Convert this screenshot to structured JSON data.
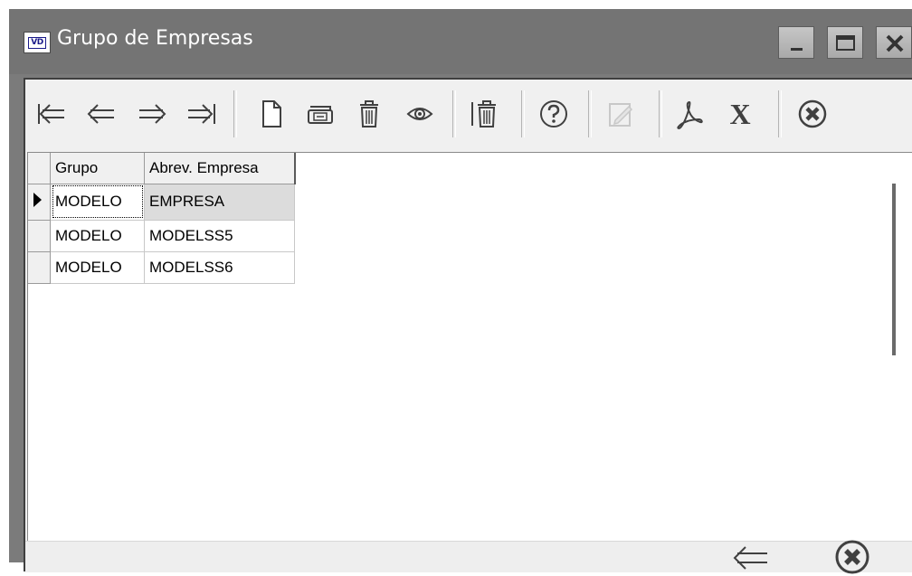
{
  "window": {
    "title": "Grupo de Empresas",
    "app_icon_text": "VD"
  },
  "title_buttons": [
    "minimize-icon",
    "maximize-icon",
    "close-icon"
  ],
  "toolbar": {
    "buttons": [
      {
        "name": "first-record-icon",
        "enabled": true
      },
      {
        "name": "previous-record-icon",
        "enabled": true
      },
      {
        "name": "next-record-icon",
        "enabled": true
      },
      {
        "name": "last-record-icon",
        "enabled": true
      },
      {
        "name": "new-document-icon",
        "enabled": true
      },
      {
        "name": "open-folder-icon",
        "enabled": true
      },
      {
        "name": "delete-trash-icon",
        "enabled": true
      },
      {
        "name": "view-eye-icon",
        "enabled": true
      },
      {
        "name": "delete-all-icon",
        "enabled": true
      },
      {
        "name": "help-icon",
        "enabled": true
      },
      {
        "name": "edit-icon",
        "enabled": false
      },
      {
        "name": "pdf-icon",
        "enabled": true
      },
      {
        "name": "excel-icon",
        "enabled": true
      },
      {
        "name": "close-circle-icon",
        "enabled": true
      }
    ],
    "excel_label": "X"
  },
  "grid": {
    "columns": [
      "Grupo",
      "Abrev. Empresa"
    ],
    "rows": [
      {
        "grupo": "MODELO",
        "empresa": "EMPRESA",
        "selected": true
      },
      {
        "grupo": "MODELO",
        "empresa": "MODELSS5",
        "selected": false
      },
      {
        "grupo": "MODELO",
        "empresa": "MODELSS6",
        "selected": false
      }
    ]
  },
  "footer": {
    "buttons": [
      "back-arrow-icon",
      "close-circle-icon"
    ]
  },
  "colors": {
    "titlebar": "#747474",
    "face": "#f0f0f0",
    "icon": "#404040",
    "selected_cell": "#dcdcdc"
  }
}
